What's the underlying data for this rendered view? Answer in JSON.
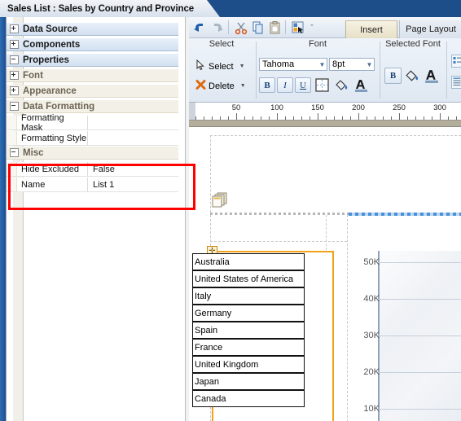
{
  "document_tab": {
    "title": "Sales List : Sales by Country and Province"
  },
  "properties_panel": {
    "sections": [
      {
        "label": "Data Source",
        "expanded": false,
        "level": "major"
      },
      {
        "label": "Components",
        "expanded": false,
        "level": "major"
      },
      {
        "label": "Properties",
        "expanded": true,
        "level": "major"
      },
      {
        "label": "Font",
        "expanded": false,
        "level": "minor"
      },
      {
        "label": "Appearance",
        "expanded": false,
        "level": "minor"
      },
      {
        "label": "Data Formatting",
        "expanded": true,
        "level": "minor"
      },
      {
        "label": "Misc",
        "expanded": true,
        "level": "minor"
      }
    ],
    "rows": [
      {
        "name": "Formatting Mask",
        "value": ""
      },
      {
        "name": "Formatting Style",
        "value": ""
      },
      {
        "name": "Hide Excluded",
        "value": "False"
      },
      {
        "name": "Name",
        "value": "List 1"
      }
    ],
    "highlight_color": "#ff0000"
  },
  "quick_access_toolbar": {
    "items": [
      {
        "name": "undo-icon",
        "label": "Undo"
      },
      {
        "name": "redo-icon",
        "label": "Redo"
      },
      {
        "name": "cut-icon",
        "label": "Cut"
      },
      {
        "name": "copy-icon",
        "label": "Copy"
      },
      {
        "name": "paste-icon",
        "label": "Paste"
      },
      {
        "name": "format-painter-icon",
        "label": "Format Painter"
      }
    ],
    "dropdown_caret": "ˇ"
  },
  "ribbon_tabs": [
    {
      "label": "Insert",
      "active": true
    },
    {
      "label": "Page Layout",
      "active": false
    }
  ],
  "ribbon_groups": [
    {
      "title": "Select",
      "buttons": [
        {
          "label": "Select",
          "icon": "cursor-arrow-icon",
          "has_dropdown": true
        },
        {
          "label": "Delete",
          "icon": "delete-x-icon",
          "has_dropdown": true
        }
      ]
    },
    {
      "title": "Font",
      "font_name": "Tahoma",
      "font_size": "8pt",
      "buttons": [
        {
          "label": "B",
          "name": "bold-button",
          "active": true
        },
        {
          "label": "I",
          "name": "italic-button",
          "active": false
        },
        {
          "label": "U",
          "name": "underline-button",
          "active": false
        },
        {
          "label": "",
          "name": "borders-icon",
          "active": false
        },
        {
          "label": "",
          "name": "fill-color-icon",
          "active": false
        },
        {
          "label": "",
          "name": "font-color-icon",
          "active": false
        }
      ]
    },
    {
      "title": "Selected Font",
      "buttons": [
        {
          "label": "B",
          "name": "selected-bold-button",
          "active": true
        },
        {
          "label": "",
          "name": "selected-fill-color-icon",
          "active": false
        },
        {
          "label": "",
          "name": "selected-font-color-icon",
          "active": false
        }
      ]
    }
  ],
  "ruler": {
    "ticks": [
      50,
      100,
      150,
      200,
      250,
      300
    ],
    "unit_step": 10
  },
  "canvas": {
    "list_items": [
      "Australia",
      "United States of America",
      "Italy",
      "Germany",
      "Spain",
      "France",
      "United Kingdom",
      "Japan",
      "Canada"
    ],
    "selection_color": "#f0a31a",
    "move_handle_glyph": "✛"
  },
  "chart_data": {
    "type": "bar",
    "title": "",
    "xlabel": "",
    "ylabel": "",
    "categories": [],
    "values": [],
    "ytick_labels": [
      "50K",
      "40K",
      "30K",
      "20K",
      "10K"
    ],
    "ytick_values": [
      50000,
      40000,
      30000,
      20000,
      10000
    ],
    "ylim": [
      0,
      50000
    ],
    "grid": true,
    "legend": "none"
  }
}
